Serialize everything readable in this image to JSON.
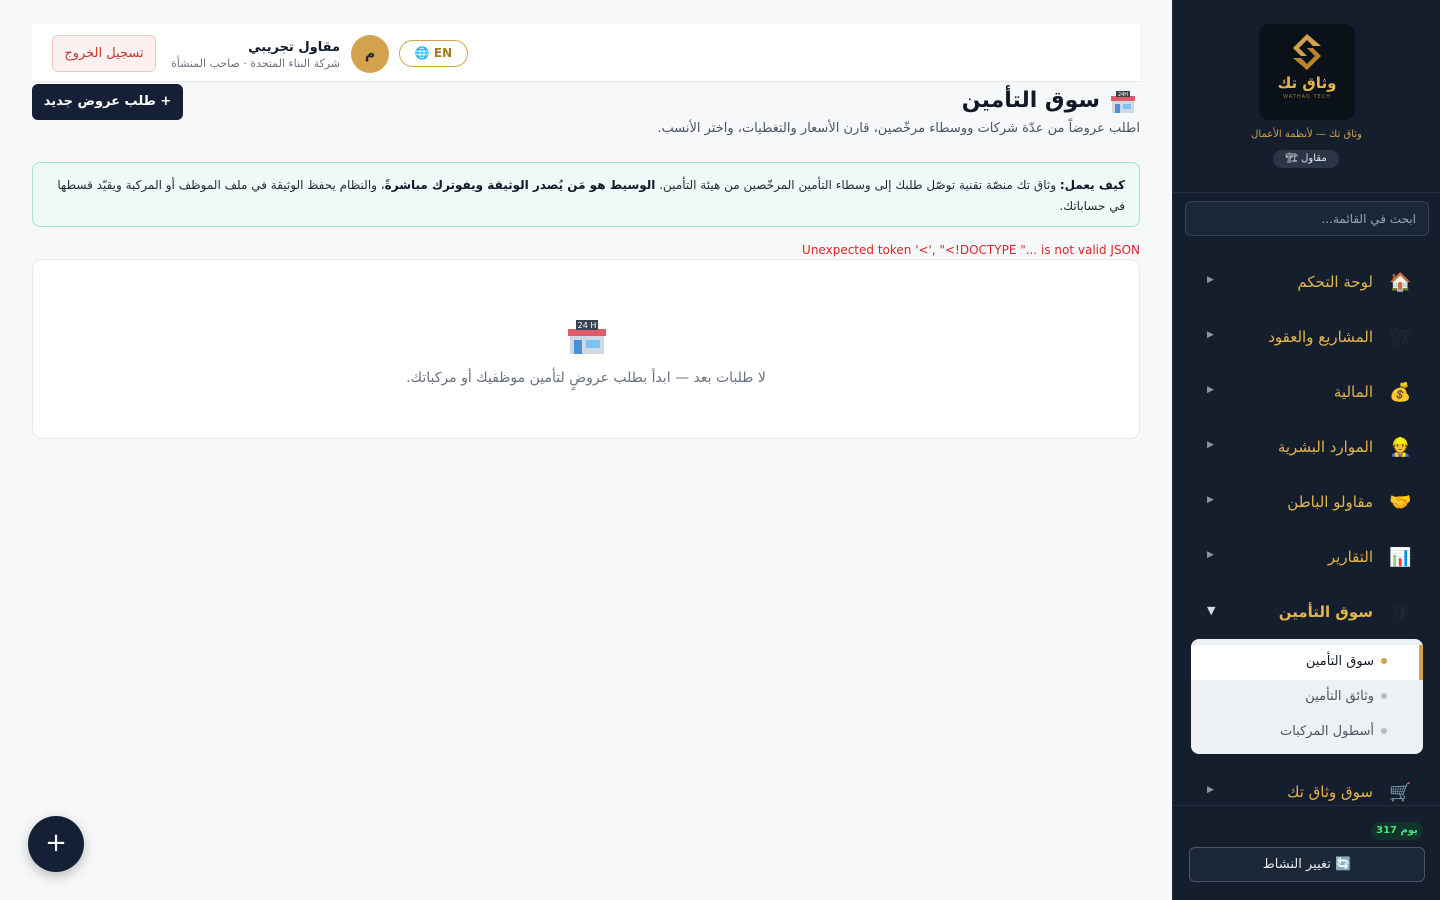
{
  "sidebar": {
    "logo_text": "وثاق تك",
    "logo_tiny": "WATHAQ TECH",
    "tagline": "وثاق تك — لأنظمة الأعمال",
    "role_badge": "🏗 مقاول",
    "search_placeholder": "ابحث في القائمة...",
    "nav": [
      {
        "label": "لوحة التحكم",
        "icon": "🏠",
        "icon_name": "home-icon"
      },
      {
        "label": "المشاريع والعقود",
        "icon": "🏗",
        "icon_name": "crane-icon"
      },
      {
        "label": "المالية",
        "icon": "💰",
        "icon_name": "money-bag-icon"
      },
      {
        "label": "الموارد البشرية",
        "icon": "👷",
        "icon_name": "worker-icon"
      },
      {
        "label": "مقاولو الباطن",
        "icon": "🤝",
        "icon_name": "handshake-icon"
      },
      {
        "label": "التقارير",
        "icon": "📊",
        "icon_name": "bar-chart-icon"
      },
      {
        "label": "سوق التأمين",
        "icon": "🛡",
        "icon_name": "shield-icon"
      },
      {
        "label": "سوق وثاق تك",
        "icon": "🛒",
        "icon_name": "cart-icon"
      }
    ],
    "submenu": [
      {
        "label": "سوق التأمين"
      },
      {
        "label": "وثائق التأمين"
      },
      {
        "label": "أسطول المركبات"
      }
    ],
    "days_badge": "317 يوم",
    "switch_activity": "🔄 تغيير النشاط"
  },
  "topbar": {
    "logout": "تسجيل الخروج",
    "user_name": "مقاول تجريبي",
    "user_company": "شركة البناء المتحدة · صاحب المنشأة",
    "avatar_letter": "م",
    "lang": "🌐 EN"
  },
  "main": {
    "new_request": "+ طلب عروض جديد",
    "title": "سوق التأمين",
    "subtitle": "اطلب عروضاً من عدّة شركات ووسطاء مرخّصين، قارن الأسعار والتغطيات، واختر الأنسب.",
    "info": {
      "lead": "كيف يعمل:",
      "text1": " وثاق تك منصّة تقنية توصّل طلبك إلى وسطاء التأمين المرخّصين من هيئة التأمين. ",
      "bold2": "الوسيط هو مَن يُصدر الوثيقة ويفوترك مباشرةً",
      "text2": "، والنظام يحفظ الوثيقة في ملف الموظف أو المركبة ويقيّد قسطها في حساباتك."
    },
    "error": "Unexpected token '<', \"<!DOCTYPE \"... is not valid JSON",
    "empty_text": "لا طلبات بعد — ابدأ بطلب عروضٍ لتأمين موظفيك أو مركباتك."
  },
  "fab": "+",
  "colors": {
    "sidebar_bg": "#141e2d",
    "accent_gold": "#d4a24c",
    "primary_dark": "#152036",
    "error_red": "#dc2626",
    "info_bg": "#eefaf5"
  }
}
